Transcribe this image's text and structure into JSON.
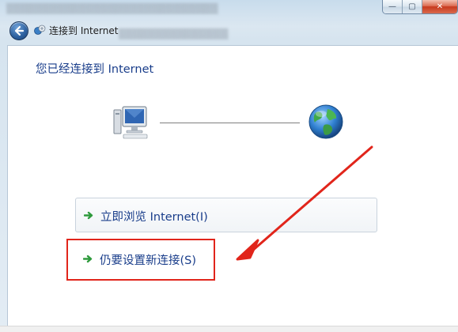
{
  "window": {
    "nav_title": "连接到 Internet",
    "controls": {
      "minimize": "—",
      "maximize": "▢",
      "close": "✕"
    }
  },
  "main": {
    "heading": "您已经连接到 Internet",
    "options": [
      {
        "label": "立即浏览 Internet(I)"
      },
      {
        "label": "仍要设置新连接(S)"
      }
    ]
  },
  "icons": {
    "back": "back-arrow-icon",
    "network": "network-connection-icon",
    "computer": "computer-icon",
    "globe": "globe-icon",
    "option_arrow": "green-arrow-icon"
  },
  "colors": {
    "link_text": "#1a3e8b",
    "option_arrow": "#2e9a3c",
    "annotation": "#e1251b"
  }
}
